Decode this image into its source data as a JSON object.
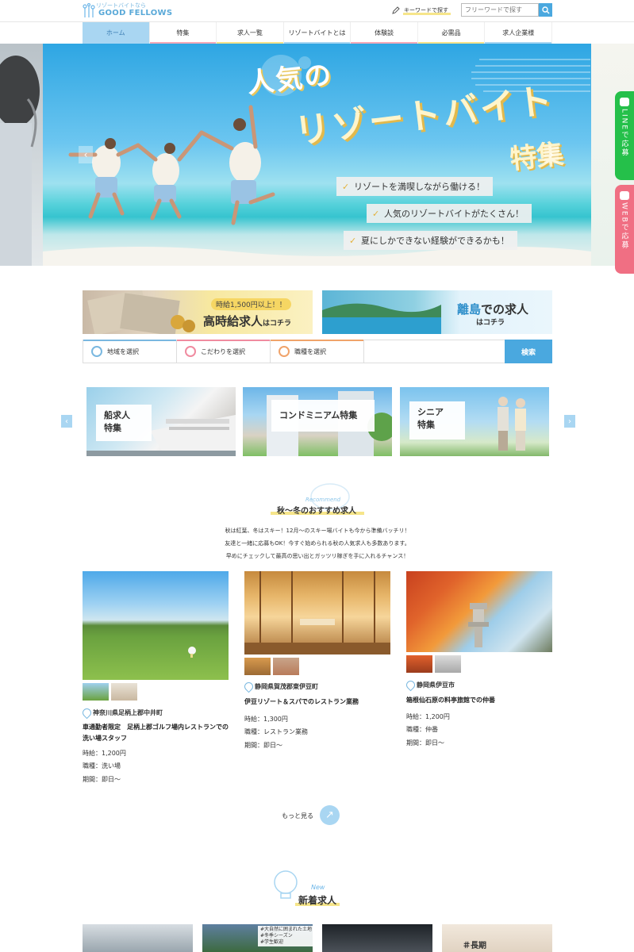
{
  "header": {
    "logo_tagline": "リゾートバイトなら",
    "logo_name": "GOOD FELLOWS",
    "keyword_label": "キーワードで探す",
    "search_placeholder": "フリーワードで探す"
  },
  "nav": {
    "items": [
      {
        "label": "ホーム",
        "color": "#a9d6f2"
      },
      {
        "label": "特集",
        "color": "#f4a9b8"
      },
      {
        "label": "求人一覧",
        "color": "#f5e28a"
      },
      {
        "label": "リゾートバイトとは",
        "color": "#a9d6f2"
      },
      {
        "label": "体験談",
        "color": "#f4a9b8"
      },
      {
        "label": "必需品",
        "color": "#f5e28a"
      },
      {
        "label": "求人企業様",
        "color": "#a9d6f2"
      }
    ]
  },
  "hero": {
    "title_line1": "人気の",
    "title_line2": "リゾートバイト",
    "title_line3": "特集",
    "bullets": [
      "リゾートを満喫しながら働ける！",
      "人気のリゾートバイトがたくさん！",
      "夏にしかできない経験ができるかも！"
    ]
  },
  "side_tabs": {
    "line": "LINEで応募",
    "web": "WEBで応募"
  },
  "promos": {
    "high_pay_small": "時給1,500円以上！！",
    "high_pay_big": "高時給求人",
    "high_pay_suffix": "はコチラ",
    "island_big_pre": "離島",
    "island_big_post": "での求人",
    "island_small": "はコチラ"
  },
  "filter": {
    "area": "地域を選択",
    "preference": "こだわりを選択",
    "job_type": "職種を選択",
    "search_button": "検索"
  },
  "features": [
    {
      "label": "船求人\n特集"
    },
    {
      "label": "コンドミニアム特集"
    },
    {
      "label": "シニア\n特集"
    }
  ],
  "recommend": {
    "en": "Recommend",
    "title": "秋〜冬のおすすめ求人",
    "desc1": "秋は紅葉、冬はスキー！12月〜のスキー場バイトも今から準備バッチリ！",
    "desc2": "友達と一緒に応募もOK！今すぐ始められる秋の人気求人も多数あります。",
    "desc3": "早めにチェックして最高の思い出とガッツリ稼ぎを手に入れるチャンス！"
  },
  "jobs": [
    {
      "location": "神奈川県足柄上郡中井町",
      "title": "車通勤者限定　足柄上郡ゴルフ場内レストランでの洗い場スタッフ",
      "wage": "時給：1,200円",
      "type": "職種：洗い場",
      "period": "期間：即日〜"
    },
    {
      "location": "静岡県賀茂郡東伊豆町",
      "title": "伊豆リゾート＆スパでのレストラン業務",
      "wage": "時給：1,300円",
      "type": "職種：レストラン業務",
      "period": "期間：即日〜"
    },
    {
      "location": "静岡県伊豆市",
      "title": "箱根仙石原の料亭旅館での仲番",
      "wage": "時給：1,200円",
      "type": "職種：仲番",
      "period": "期間：即日〜"
    }
  ],
  "more": {
    "label": "もっと見る"
  },
  "new_section": {
    "en": "New",
    "title": "新着求人"
  },
  "new_tags": [
    "#大自然に囲まれた土地",
    "#冬季シーズン",
    "#学生歓迎"
  ],
  "new_tag_right": "＃長期",
  "colors": {
    "accent": "#4aa8df",
    "line_green": "#25c04a",
    "web_pink": "#f06f83",
    "highlight": "#f6e58a"
  }
}
